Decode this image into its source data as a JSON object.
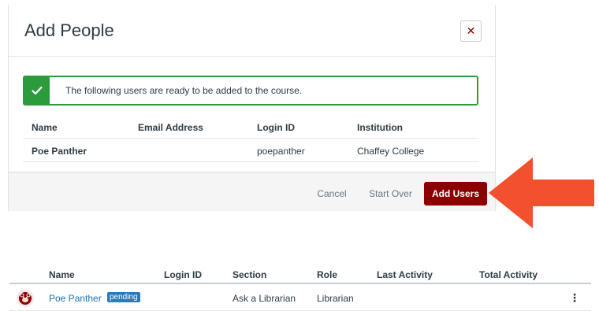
{
  "modal": {
    "title": "Add People",
    "close_symbol": "✕",
    "alert": {
      "icon": "checkmark-icon",
      "message": "The following users are ready to be added to the course."
    },
    "table": {
      "headers": [
        "Name",
        "Email Address",
        "Login ID",
        "Institution"
      ],
      "rows": [
        {
          "name": "Poe Panther",
          "email": "",
          "login_id": "poepanther",
          "institution": "Chaffey College"
        }
      ]
    },
    "footer": {
      "cancel_label": "Cancel",
      "start_over_label": "Start Over",
      "add_users_label": "Add Users"
    }
  },
  "arrow": {
    "color": "#f2502f"
  },
  "people": {
    "headers": [
      "Name",
      "Login ID",
      "Section",
      "Role",
      "Last Activity",
      "Total Activity"
    ],
    "rows": [
      {
        "name": "Poe Panther",
        "badge": "pending",
        "login_id": "",
        "section": "Ask a Librarian",
        "role": "Librarian",
        "last_activity": "",
        "total_activity": ""
      }
    ]
  },
  "colors": {
    "brand": "#8b0000",
    "success": "#2c9b3b",
    "link": "#1f6fae",
    "badge": "#2b7abc"
  }
}
